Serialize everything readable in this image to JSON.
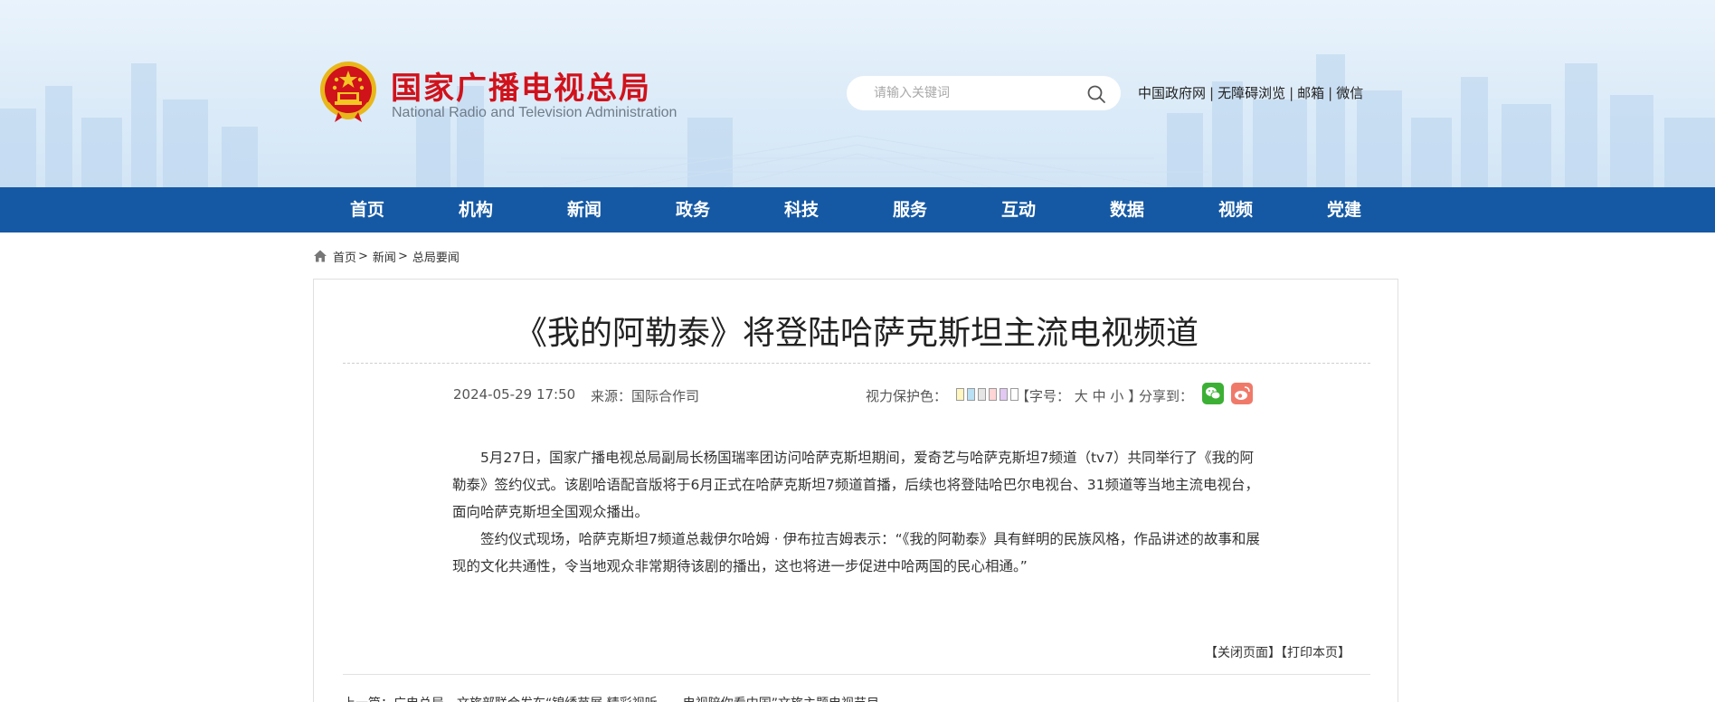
{
  "header": {
    "site_title": "国家广播电视总局",
    "site_subtitle": "National Radio and Television Administration",
    "emblem_icon": "national-emblem-icon",
    "search_placeholder": "请输入关键词",
    "top_links": [
      "中国政府网",
      "无障碍浏览",
      "邮箱",
      "微信"
    ]
  },
  "nav": {
    "items": [
      "首页",
      "机构",
      "新闻",
      "政务",
      "科技",
      "服务",
      "互动",
      "数据",
      "视频",
      "党建"
    ]
  },
  "breadcrumb": {
    "items": [
      "首页",
      "新闻",
      "总局要闻"
    ],
    "separator": ">"
  },
  "article": {
    "title": "《我的阿勒泰》将登陆哈萨克斯坦主流电视频道",
    "date": "2024-05-29 17:50",
    "source": "来源：国际合作司",
    "eye_protection_label": "视力保护色：",
    "eye_protection_colors": [
      "#fff6c0",
      "#b9e0f5",
      "#e5e5e5",
      "#ffd5d5",
      "#e2c8f2",
      "#ffffff"
    ],
    "font_size_label": "【字号：",
    "font_size_options": [
      "大",
      "中",
      "小"
    ],
    "font_size_close": "】",
    "share_label": "分享到：",
    "paragraphs": [
      "5月27日，国家广播电视总局副局长杨国瑞率团访问哈萨克斯坦期间，爱奇艺与哈萨克斯坦7频道（tv7）共同举行了《我的阿勒泰》签约仪式。该剧哈语配音版将于6月正式在哈萨克斯坦7频道首播，后续也将登陆哈巴尔电视台、31频道等当地主流电视台，面向哈萨克斯坦全国观众播出。",
      "签约仪式现场，哈萨克斯坦7频道总裁伊尔哈姆 · 伊布拉吉姆表示：“《我的阿勒泰》具有鲜明的民族风格，作品讲述的故事和展现的文化共通性，令当地观众非常期待该剧的播出，这也将进一步促进中哈两国的民心相通。”"
    ],
    "close_page": "【关闭页面】",
    "print_page": "【打印本页】",
    "prev_article": "上一篇：广电总局、文旅部联合发布“锦绣苗展 精彩视听——电视陪你看中国”文旅主题电视节目"
  },
  "colors": {
    "nav_bg": "#1559a4",
    "title_red": "#d0121b",
    "wechat_green": "#3cb034",
    "weibo_red": "#f07a6a"
  }
}
